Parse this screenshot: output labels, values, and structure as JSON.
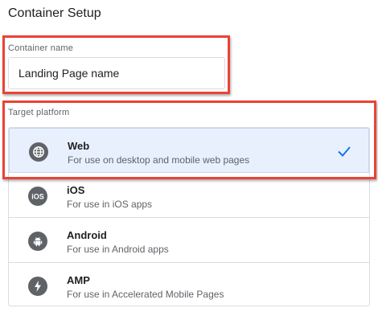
{
  "title": "Container Setup",
  "container_name": {
    "label": "Container name",
    "value": "Landing Page name"
  },
  "target_platform": {
    "label": "Target platform",
    "selected": "Web",
    "options": [
      {
        "title": "Web",
        "description": "For use on desktop and mobile web pages",
        "icon": "globe-icon"
      },
      {
        "title": "iOS",
        "description": "For use in iOS apps",
        "icon": "ios-icon"
      },
      {
        "title": "Android",
        "description": "For use in Android apps",
        "icon": "android-icon"
      },
      {
        "title": "AMP",
        "description": "For use in Accelerated Mobile Pages",
        "icon": "amp-bolt-icon"
      }
    ]
  },
  "colors": {
    "highlight_border": "#ea4335",
    "selected_bg": "#e8f0fe",
    "check": "#1a73e8",
    "icon_bg": "#5f6368"
  }
}
